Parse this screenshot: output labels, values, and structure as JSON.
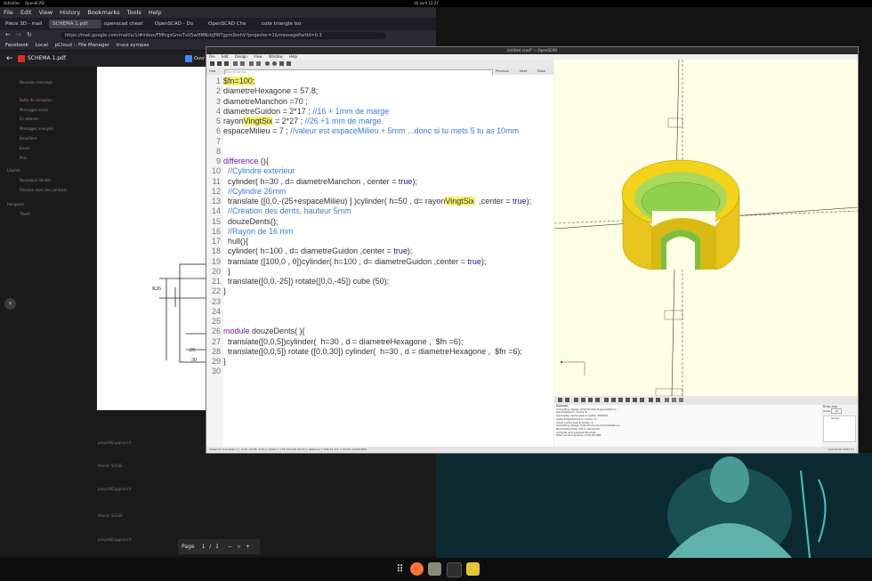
{
  "topbar": {
    "activities": "Activities",
    "app": "OpenSCAD",
    "clock": "16 avril  12:27"
  },
  "firefox": {
    "menu": [
      "File",
      "Edit",
      "View",
      "History",
      "Bookmarks",
      "Tools",
      "Help"
    ],
    "tabs": [
      "Pièce 3D - mail",
      "SCHEMA 1.pdf",
      "openscad cheat",
      "OpenSCAD - Do",
      "OpenSCAD Che",
      "cote triangle iso"
    ],
    "url": "https://mail.google.com/mail/u/1/#inbox/FMfcgzGmvTxVSwHMNcbJfWTgymSmhV?projector=1&messagePartId=0.3",
    "bookmarks": [
      "Facebook",
      "Local",
      "pCloud :: File Manager",
      "trucs sympas"
    ],
    "pdf_title": "SCHEMA 1.pdf",
    "pdf_side": "Ouvr",
    "pager": {
      "label": "Page",
      "current": "1",
      "sep": "/",
      "total": "1"
    }
  },
  "mail_sidebar": [
    "Nouveau message",
    "Boîte de réception",
    "Messages suivis",
    "En attente",
    "Messages envoyés",
    "Brouillons",
    "Envoi",
    "Plus",
    "Libellés",
    "Nouveaux libellés",
    "Réunion avec des contacts",
    "Hangouts",
    "Tibert"
  ],
  "mail_rows": [
    "pieyklt82@gmail.fr",
    "Manon SUSSE",
    "pieyklt82@gmail.fr",
    "Manon SUSSE",
    "pieyklt82@gmail.fr"
  ],
  "openscad": {
    "title": "Untitled.scad* — OpenSCAD",
    "menu": [
      "File",
      "Edit",
      "Design",
      "View",
      "Window",
      "Help"
    ],
    "find_label": "Find",
    "find_placeholder": "Search string",
    "find_buttons": [
      "Previous",
      "Next",
      "Done"
    ],
    "line_numbers": [
      "1",
      "2",
      "3",
      "4",
      "5",
      "6",
      "7",
      "8",
      "9",
      "10",
      "11",
      "12",
      "13",
      "14",
      "15",
      "16",
      "17",
      "18",
      "19",
      "20",
      "21",
      "22",
      "23",
      "24",
      "25",
      "26",
      "27",
      "28",
      "29",
      "30"
    ],
    "code": [
      {
        "t": "$fn=100;",
        "c": "cm0"
      },
      {
        "t": "diametreHexagone = 57.8;"
      },
      {
        "t": "diametreManchon =70 ;"
      },
      {
        "t": "diametreGuidon = 2*17 ; //16 + 1mm de marge"
      },
      {
        "t": "rayonVingtSix = 2*27 ; //26 +1 mm de marge"
      },
      {
        "t": "espaceMilieu = 7 ; //valeur est espaceMilieu + 5mm ...donc si tu mets 5 tu as 10mm"
      },
      {
        "t": ""
      },
      {
        "t": ""
      },
      {
        "t": "difference (){"
      },
      {
        "t": "  //Cylindre exterieur"
      },
      {
        "t": "  cylinder( h=30 , d= diametreManchon , center = true);"
      },
      {
        "t": "  //Cylindre 26mm"
      },
      {
        "t": "  translate ([0,0,-(25+espaceMilieu) ] )cylinder( h=50 , d= rayonVingtSix  ,center = true);"
      },
      {
        "t": "  //Creation des dents, hauteur 5mm"
      },
      {
        "t": "  douzeDents();"
      },
      {
        "t": "  //Rayon de 16 mm"
      },
      {
        "t": "  hull(){"
      },
      {
        "t": "  cylinder( h=100 , d= diametreGuidon ,center = true);"
      },
      {
        "t": "  translate ([100,0 , 0])cylinder( h=100 , d= diametreGuidon ,center = true);"
      },
      {
        "t": "  }"
      },
      {
        "t": "  translate([0,0,-25]) rotate([0,0,-45]) cube (50);"
      },
      {
        "t": "}"
      },
      {
        "t": ""
      },
      {
        "t": ""
      },
      {
        "t": ""
      },
      {
        "t": "module douzeDents( ){"
      },
      {
        "t": "  translate([0,0,5])cylinder(  h=30 , d = diametreHexagone ,  $fn =6);"
      },
      {
        "t": "  translate([0,0,5]) rotate ([0,0,30]) cylinder(  h=30 , d = diametreHexagone ,  $fn =6);"
      },
      {
        "t": "}"
      },
      {
        "t": ""
      }
    ],
    "console_title": "Console",
    "console_lines": [
      "Compiling design (CSG Products generation)...",
      "Geometries in cache: 6",
      "Geometry cache size in bytes: 356640",
      "CGAL Polyhedrons in cache: 0",
      "CGAL cache size in bytes: 0",
      "Compiling design (CSG Products normalization)...",
      "Normalized tree has 4 elements!",
      "Compile and preview finished.",
      "Total rendering time: 0:00:00.080"
    ],
    "errorlog_title": "Error-Log",
    "errorlog_show": "Show",
    "errorlog_filter": "All",
    "errorlog_col": "Group",
    "status": "Viewport: translate = [ -9.26 -19.05 -5.59 ], rotate = [ 55.00 0.00 25.00 ], distance = 592.41, fov = 22.50 (1049x380)",
    "version": "OpenSCAD 2021.01"
  },
  "colors": {
    "yellow": "#f2d31a",
    "green": "#8fd14f",
    "viewport_bg": "#ffffe5",
    "teal": "#0b2a30"
  }
}
